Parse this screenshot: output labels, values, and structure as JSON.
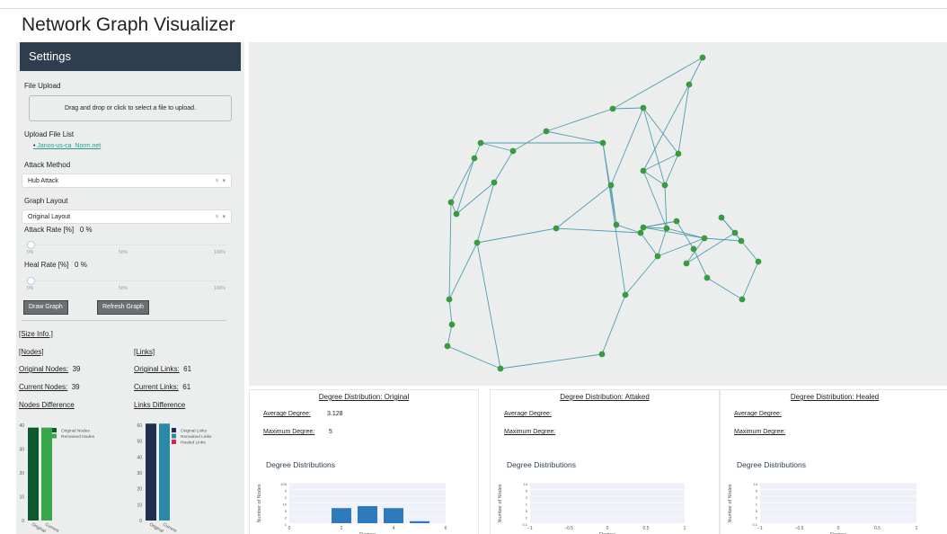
{
  "app": {
    "title": "Network Graph Visualizer"
  },
  "settings": {
    "header": "Settings",
    "file_upload_label": "File Upload",
    "upload_prompt": "Drag and drop or click to select a file to upload.",
    "upload_list_label": "Upload File List",
    "uploaded_file": "Janos-us-ca_Norm.net",
    "attack_method_label": "Attack Method",
    "attack_method_value": "Hub Attack",
    "graph_layout_label": "Graph Layout",
    "graph_layout_value": "Original Layout",
    "select_clear": "×",
    "select_arrow": "▾",
    "attack_rate_label": "Attack Rate [%]",
    "attack_rate_value": "0 %",
    "attack_rate_level": 0,
    "heal_rate_label": "Heal Rate [%]",
    "heal_rate_value": "0 %",
    "heal_rate_level": 0,
    "slider_marks": [
      "0%",
      "50%",
      "100%"
    ],
    "draw_button": "Draw Graph",
    "refresh_button": "Refresh Graph"
  },
  "size_info": {
    "title": "[Size Info.]",
    "nodes_header": "[Nodes]",
    "links_header": "[Links]",
    "original_nodes_label": "Original Nodes:",
    "original_nodes_value": "39",
    "current_nodes_label": "Current Nodes:",
    "current_nodes_value": "39",
    "original_links_label": "Original Links:",
    "original_links_value": "61",
    "current_links_label": "Current Links:",
    "current_links_value": "61",
    "nodes_diff_label": "Nodes Difference",
    "links_diff_label": "Links Difference"
  },
  "chart_data": [
    {
      "type": "bar",
      "title": "Nodes Difference",
      "categories": [
        "Original",
        "Current"
      ],
      "ylim": [
        0,
        40
      ],
      "yticks": [
        "0",
        "10",
        "20",
        "30",
        "40"
      ],
      "series": [
        {
          "name": "Original Nodes",
          "values": [
            39,
            0
          ],
          "color": "#0c5a2b"
        },
        {
          "name": "Remained Nodes",
          "values": [
            0,
            39
          ],
          "color": "#3aa64b"
        }
      ],
      "legend": "top-right"
    },
    {
      "type": "bar",
      "title": "Links Difference",
      "categories": [
        "Original",
        "Current"
      ],
      "ylim": [
        0,
        60
      ],
      "yticks": [
        "0",
        "10",
        "20",
        "30",
        "40",
        "50",
        "60"
      ],
      "series": [
        {
          "name": "Original Links",
          "values": [
            61,
            0
          ],
          "color": "#1f2e4f"
        },
        {
          "name": "Remained Links",
          "values": [
            0,
            61
          ],
          "color": "#2a89a9"
        },
        {
          "name": "Healed Links",
          "values": [
            0,
            0
          ],
          "color": "#e0204a"
        }
      ],
      "legend": "top-right"
    },
    {
      "type": "bar",
      "title": "Degree Distributions",
      "xlabel": "Degree",
      "ylabel": "Number of Nodes",
      "x": [
        2,
        3,
        4,
        5
      ],
      "values": [
        15,
        17,
        15,
        2
      ],
      "xlim": [
        0,
        6
      ],
      "xticks": [
        "0",
        "2",
        "4",
        "6"
      ],
      "yticks": [
        "100",
        "5",
        "2",
        "10",
        "5",
        "2",
        "1"
      ],
      "color": "#2d7bbd"
    },
    {
      "type": "bar",
      "title": "Degree Distributions",
      "xlabel": "Degree",
      "ylabel": "Number of Nodes",
      "values": [],
      "xlim": [
        -1,
        1
      ],
      "xticks": [
        "−1",
        "−0.5",
        "0",
        "0.5",
        "1"
      ],
      "yticks": [
        "10",
        "5",
        "2",
        "1",
        "5",
        "2",
        "0.1"
      ]
    },
    {
      "type": "bar",
      "title": "Degree Distributions",
      "xlabel": "Degree",
      "ylabel": "Number of Nodes",
      "values": [],
      "xlim": [
        -1,
        1
      ],
      "xticks": [
        "−1",
        "−0.5",
        "0",
        "0.5",
        "1"
      ],
      "yticks": [
        "10",
        "5",
        "2",
        "1",
        "5",
        "2",
        "0.1"
      ]
    }
  ],
  "graph": {
    "node_color": "#3a9a3f",
    "edge_color": "#4f9db0"
  },
  "panels": [
    {
      "title": "Degree Distribution: Original",
      "avg_label": "Average Degree:",
      "avg_value": "3.128",
      "max_label": "Maximum Degree:",
      "max_value": "5",
      "dist_title": "Degree Distributions"
    },
    {
      "title": "Degree Distribution: Attaked",
      "avg_label": "Average Degree:",
      "avg_value": "",
      "max_label": "Maximum Degree:",
      "max_value": "",
      "dist_title": "Degree Distributions"
    },
    {
      "title": "Degree Distribution: Healed",
      "avg_label": "Average Degree:",
      "avg_value": "",
      "max_label": "Maximum Degree:",
      "max_value": "",
      "dist_title": "Degree Distributions"
    }
  ]
}
